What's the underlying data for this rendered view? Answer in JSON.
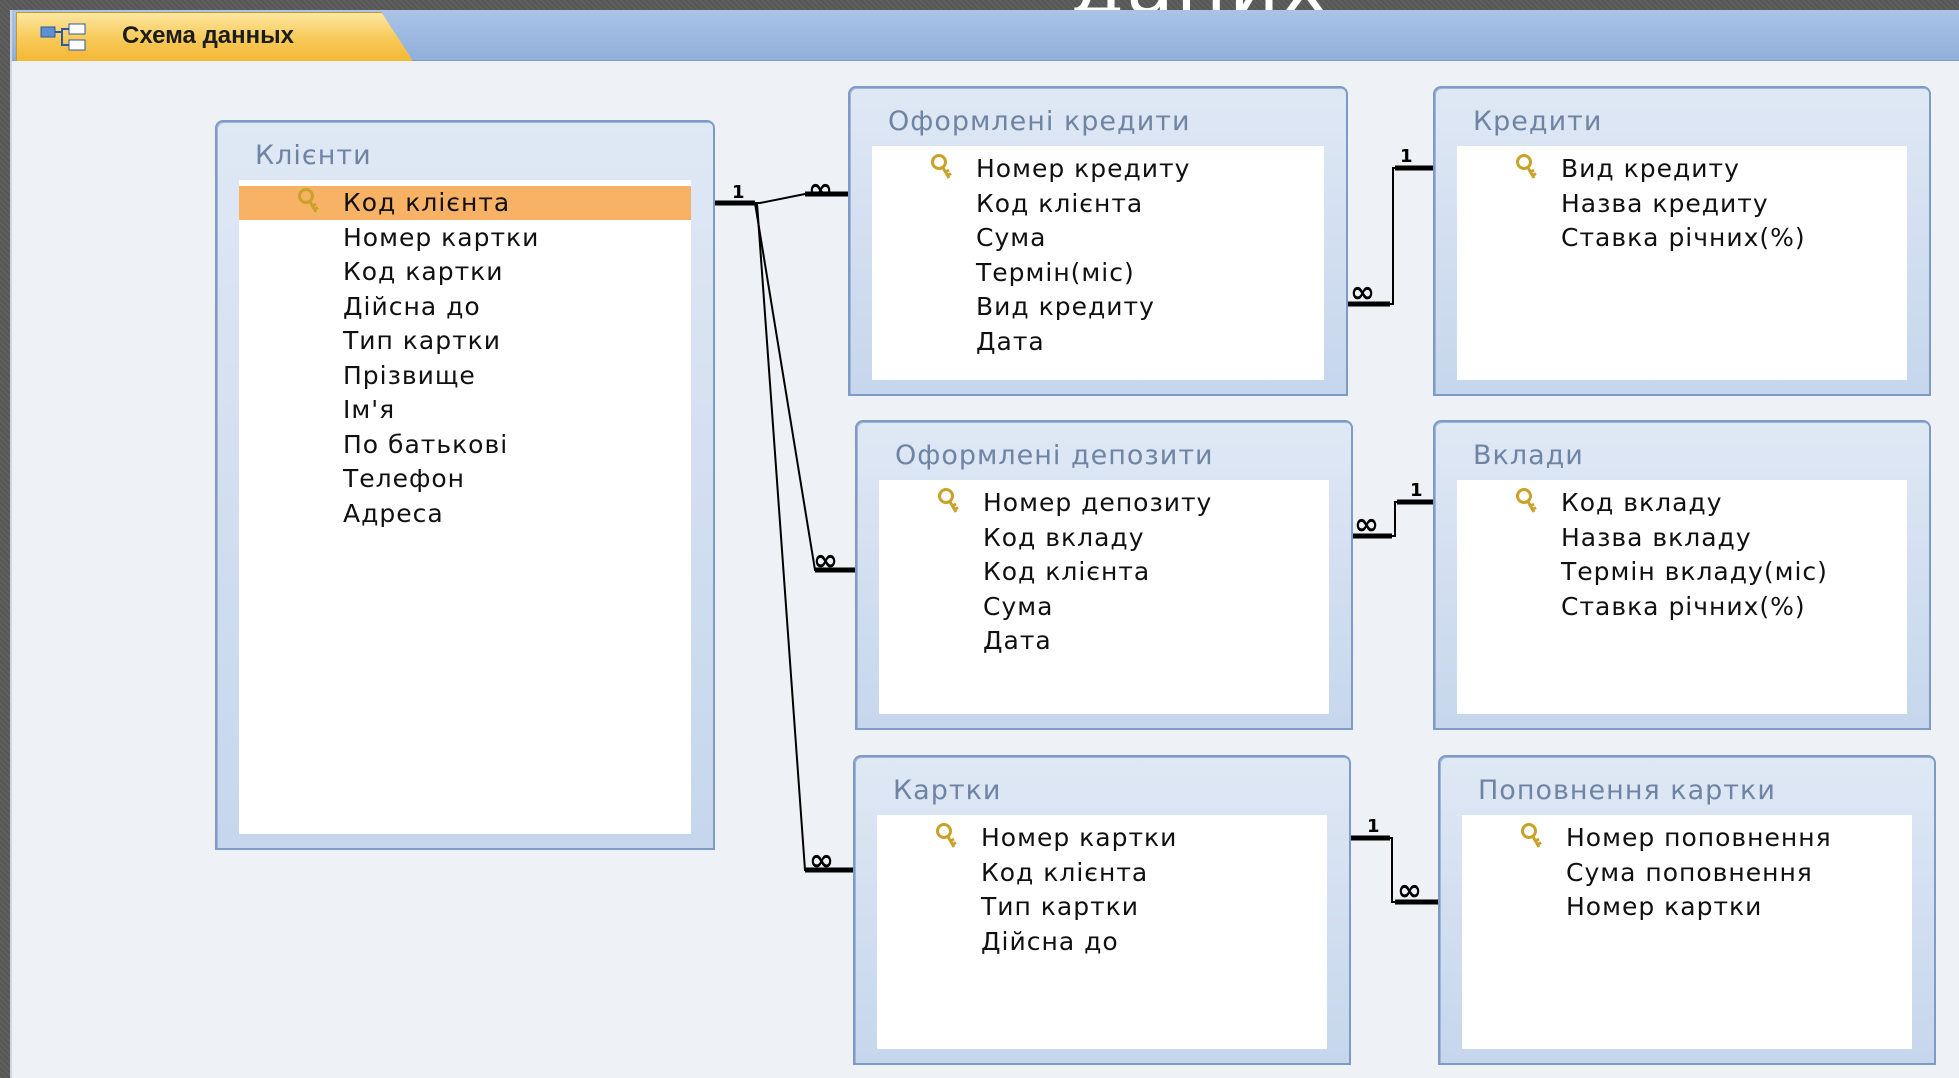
{
  "background_title_fragment": "даних",
  "window": {
    "tab_label": "Схема данных",
    "tab_icon": "relationships-icon"
  },
  "tables": [
    {
      "id": "klienty",
      "title": "Клієнти",
      "selected_field": 0,
      "fields": [
        {
          "label": "Код клієнта",
          "key": true
        },
        {
          "label": "Номер картки",
          "key": false
        },
        {
          "label": "Код картки",
          "key": false
        },
        {
          "label": "Дійсна до",
          "key": false
        },
        {
          "label": "Тип картки",
          "key": false
        },
        {
          "label": "Прізвище",
          "key": false
        },
        {
          "label": "Ім'я",
          "key": false
        },
        {
          "label": "По батькові",
          "key": false
        },
        {
          "label": "Телефон",
          "key": false
        },
        {
          "label": "Адреса",
          "key": false
        }
      ]
    },
    {
      "id": "oformleni-kredyty",
      "title": "Оформлені кредити",
      "fields": [
        {
          "label": "Номер кредиту",
          "key": true
        },
        {
          "label": "Код клієнта",
          "key": false
        },
        {
          "label": "Сума",
          "key": false
        },
        {
          "label": "Термін(міс)",
          "key": false
        },
        {
          "label": "Вид кредиту",
          "key": false
        },
        {
          "label": "Дата",
          "key": false
        }
      ]
    },
    {
      "id": "kredyty",
      "title": "Кредити",
      "fields": [
        {
          "label": "Вид кредиту",
          "key": true
        },
        {
          "label": "Назва кредиту",
          "key": false
        },
        {
          "label": "Ставка річних(%)",
          "key": false
        }
      ]
    },
    {
      "id": "oformleni-depozyty",
      "title": "Оформлені депозити",
      "fields": [
        {
          "label": "Номер депозиту",
          "key": true
        },
        {
          "label": "Код вкладу",
          "key": false
        },
        {
          "label": "Код клієнта",
          "key": false
        },
        {
          "label": "Сума",
          "key": false
        },
        {
          "label": "Дата",
          "key": false
        }
      ]
    },
    {
      "id": "vklady",
      "title": "Вклади",
      "fields": [
        {
          "label": "Код вкладу",
          "key": true
        },
        {
          "label": "Назва вкладу",
          "key": false
        },
        {
          "label": "Термін вкладу(міс)",
          "key": false
        },
        {
          "label": "Ставка річних(%)",
          "key": false
        }
      ]
    },
    {
      "id": "kartky",
      "title": "Картки",
      "fields": [
        {
          "label": "Номер картки",
          "key": true
        },
        {
          "label": "Код клієнта",
          "key": false
        },
        {
          "label": "Тип картки",
          "key": false
        },
        {
          "label": "Дійсна до",
          "key": false
        }
      ]
    },
    {
      "id": "popovnennia-kartky",
      "title": "Поповнення картки",
      "fields": [
        {
          "label": "Номер поповнення",
          "key": true
        },
        {
          "label": "Сума поповнення",
          "key": false
        },
        {
          "label": "Номер картки",
          "key": false
        }
      ]
    }
  ],
  "relationship_markers": {
    "one": "1",
    "many": "∞"
  },
  "colors": {
    "selected_row": "#f8b266",
    "tab_gold": "#f7c957",
    "tabbar_blue": "#9ab8e0",
    "box_border": "#7d9bc6",
    "key_icon": "#c9a22a"
  }
}
